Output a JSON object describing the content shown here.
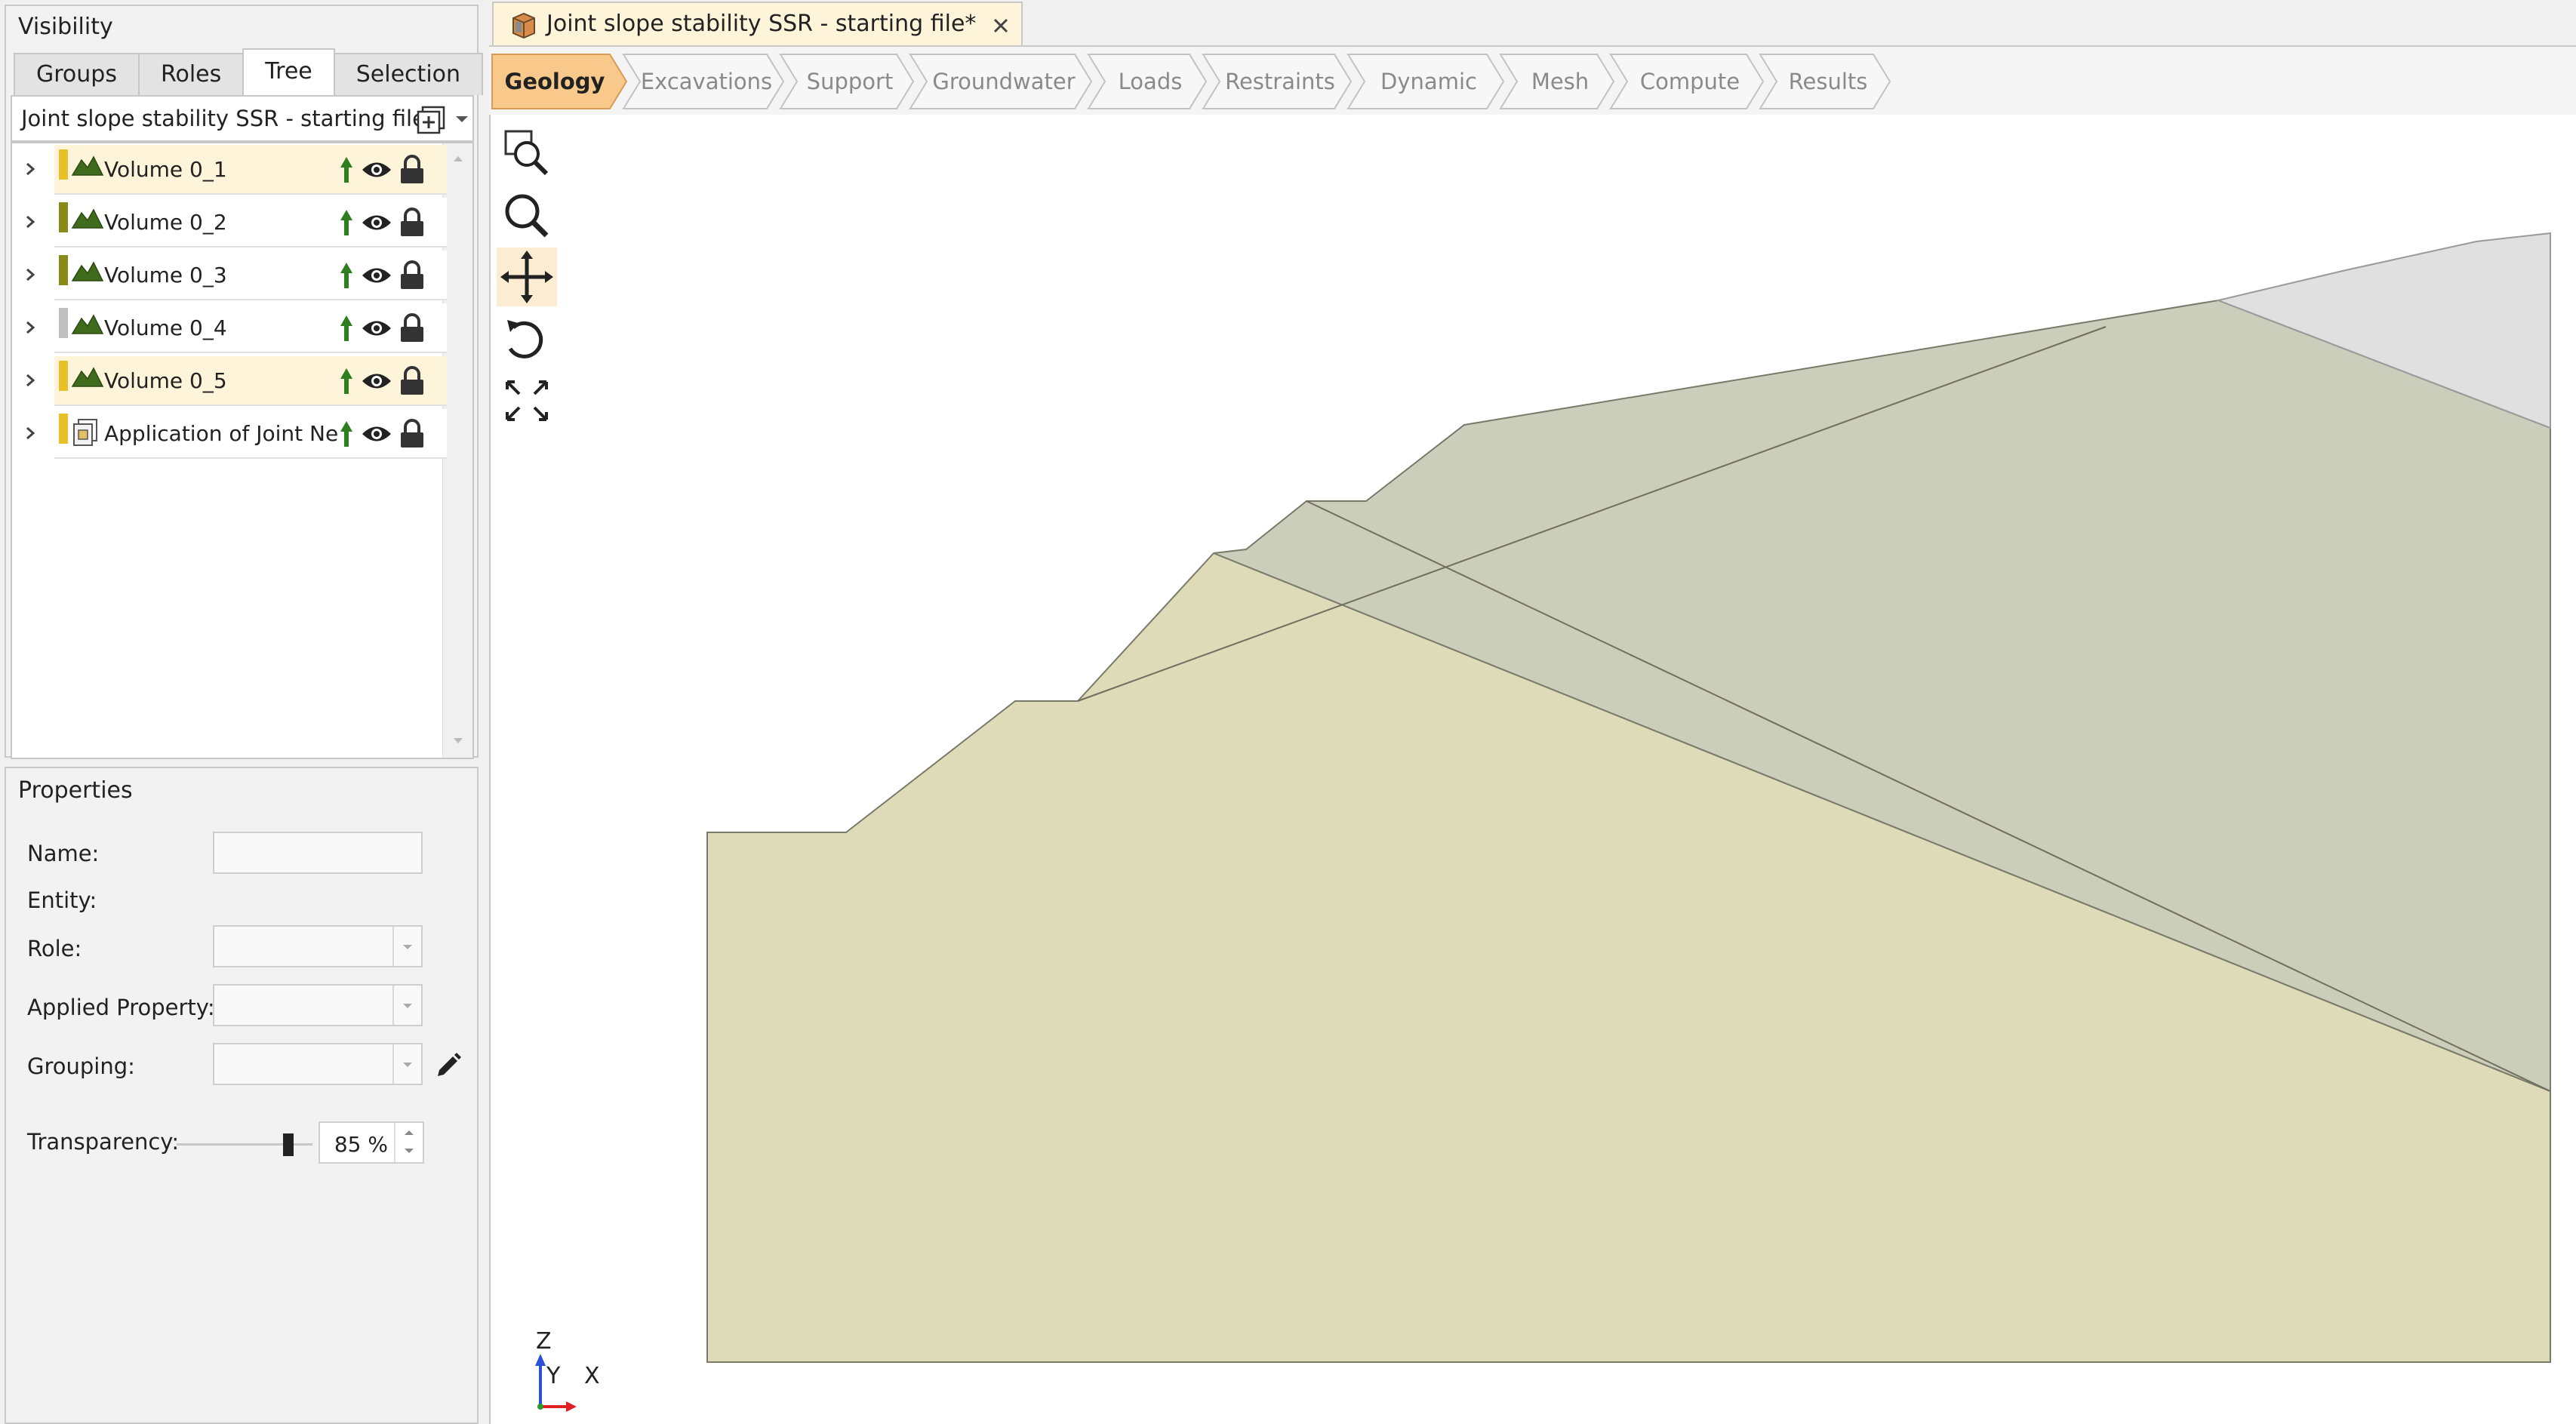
{
  "visibility": {
    "title": "Visibility",
    "tabs": [
      {
        "label": "Groups"
      },
      {
        "label": "Roles"
      },
      {
        "label": "Tree"
      },
      {
        "label": "Selection"
      }
    ],
    "active_tab": "Tree",
    "file_name": "Joint slope stability SSR - starting file",
    "items": [
      {
        "label": "Volume 0_1",
        "color": "#e8c12a",
        "highlighted": true
      },
      {
        "label": "Volume 0_2",
        "color": "#8a8a1a",
        "highlighted": false
      },
      {
        "label": "Volume 0_3",
        "color": "#8a8a1a",
        "highlighted": false
      },
      {
        "label": "Volume 0_4",
        "color": "#bfbfbf",
        "highlighted": false
      },
      {
        "label": "Volume 0_5",
        "color": "#e8c12a",
        "highlighted": true
      },
      {
        "label": "Application of Joint Netv",
        "color": "#e8c12a",
        "highlighted": false
      }
    ]
  },
  "properties": {
    "title": "Properties",
    "name_label": "Name:",
    "entity_label": "Entity:",
    "role_label": "Role:",
    "applied_property_label": "Applied Property:",
    "grouping_label": "Grouping:",
    "transparency_label": "Transparency:",
    "transparency_value": "85 %",
    "transparency_fraction": 0.85
  },
  "document": {
    "tab_title": "Joint slope stability SSR - starting file*"
  },
  "workflow": {
    "steps": [
      "Geology",
      "Excavations",
      "Support",
      "Groundwater",
      "Loads",
      "Restraints",
      "Dynamic",
      "Mesh",
      "Compute",
      "Results"
    ],
    "active": "Geology",
    "active_color": "#f9c98b"
  },
  "axes": {
    "z": "Z",
    "y": "Y",
    "x": "X"
  },
  "colors": {
    "soil_light": "#dedbb8",
    "soil_dark": "#cccebc",
    "upper_grey": "#e0e0e0",
    "icon_green": "#2e7d1e"
  }
}
